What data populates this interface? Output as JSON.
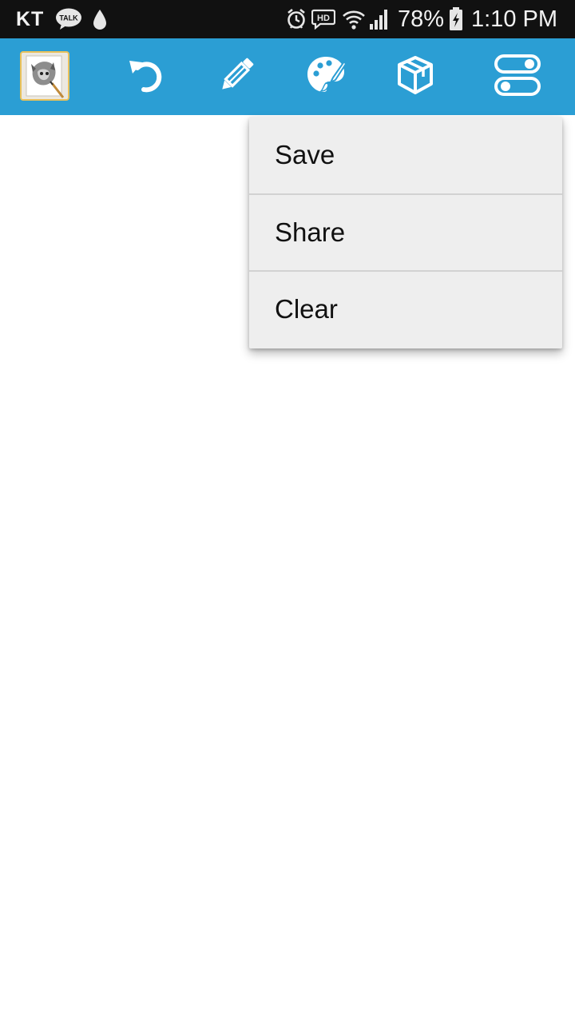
{
  "status_bar": {
    "carrier": "KT",
    "talk_badge": "TALK",
    "battery_percent": "78%",
    "time": "1:10 PM",
    "hd_badge": "HD",
    "icons": [
      "kakaotalk-icon",
      "drop-icon",
      "alarm-icon",
      "hd-voice-icon",
      "wifi-icon",
      "signal-icon",
      "battery-charging-icon"
    ]
  },
  "toolbar": {
    "color": "#2b9ed4",
    "items": [
      "app-thumbnail",
      "undo-icon",
      "pencil-icon",
      "palette-icon",
      "box-icon",
      "toggle-settings-icon"
    ]
  },
  "menu": {
    "items": [
      {
        "label": "Save"
      },
      {
        "label": "Share"
      },
      {
        "label": "Clear"
      }
    ]
  }
}
